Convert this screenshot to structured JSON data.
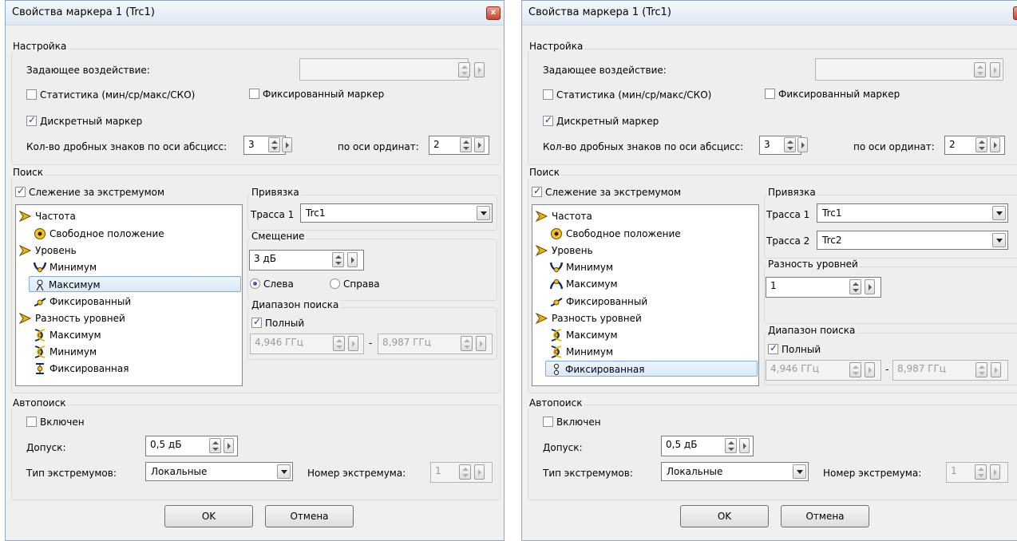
{
  "left": {
    "title": "Свойства маркера 1 (Trc1)",
    "close_label": "x",
    "setup": {
      "title": "Настройка",
      "stimulus_label": "Задающее воздействие:",
      "stimulus_value": "",
      "statistics_label": "Статистика (мин/ср/макс/СКО)",
      "statistics_checked": false,
      "fixed_marker_label": "Фиксированный маркер",
      "fixed_marker_checked": false,
      "discrete_label": "Дискретный маркер",
      "discrete_checked": true,
      "decimals_x_label": "Кол-во дробных знаков по оси абсцисс:",
      "decimals_x_value": "3",
      "decimals_y_label": "по оси ординат:",
      "decimals_y_value": "2"
    },
    "search": {
      "title": "Поиск",
      "tracking_label": "Слежение за экстремумом",
      "tracking_checked": true,
      "tree": [
        {
          "label": "Частота",
          "icon": "frequency-icon"
        },
        {
          "label": "Свободное положение",
          "icon": "free-position-icon"
        },
        {
          "label": "Уровень",
          "icon": "level-icon"
        },
        {
          "label": "Минимум",
          "icon": "minimum-icon"
        },
        {
          "label": "Максимум",
          "icon": "maximum-icon",
          "selected": true
        },
        {
          "label": "Фиксированный",
          "icon": "fixed-icon"
        },
        {
          "label": "Разность уровней",
          "icon": "level-difference-icon"
        },
        {
          "label": "Максимум",
          "icon": "diff-maximum-icon"
        },
        {
          "label": "Минимум",
          "icon": "diff-minimum-icon"
        },
        {
          "label": "Фиксированная",
          "icon": "diff-fixed-icon"
        }
      ],
      "binding": {
        "title": "Привязка",
        "trace1_label": "Трасса 1",
        "trace1_value": "Trc1"
      },
      "offset": {
        "title": "Смещение",
        "value": "3 дБ",
        "left_label": "Слева",
        "right_label": "Справа",
        "selected": "left"
      },
      "range": {
        "title": "Диапазон поиска",
        "full_label": "Полный",
        "full_checked": true,
        "start": "4,946 ГГц",
        "dash": "-",
        "stop": "8,987 ГГц"
      }
    },
    "autosearch": {
      "title": "Автопоиск",
      "enabled_label": "Включен",
      "enabled_checked": false,
      "tolerance_label": "Допуск:",
      "tolerance_value": "0,5 дБ",
      "type_label": "Тип экстремумов:",
      "type_value": "Локальные",
      "number_label": "Номер экстремума:",
      "number_value": "1"
    },
    "ok_label": "OK",
    "cancel_label": "Отмена"
  },
  "right": {
    "title": "Свойства маркера 1 (Trc1)",
    "close_label": "x",
    "setup": {
      "title": "Настройка",
      "stimulus_label": "Задающее воздействие:",
      "stimulus_value": "",
      "statistics_label": "Статистика (мин/ср/макс/СКО)",
      "statistics_checked": false,
      "fixed_marker_label": "Фиксированный маркер",
      "fixed_marker_checked": false,
      "discrete_label": "Дискретный маркер",
      "discrete_checked": true,
      "decimals_x_label": "Кол-во дробных знаков по оси абсцисс:",
      "decimals_x_value": "3",
      "decimals_y_label": "по оси ординат:",
      "decimals_y_value": "2"
    },
    "search": {
      "title": "Поиск",
      "tracking_label": "Слежение за экстремумом",
      "tracking_checked": true,
      "tree": [
        {
          "label": "Частота",
          "icon": "frequency-icon"
        },
        {
          "label": "Свободное положение",
          "icon": "free-position-icon"
        },
        {
          "label": "Уровень",
          "icon": "level-icon"
        },
        {
          "label": "Минимум",
          "icon": "minimum-icon"
        },
        {
          "label": "Максимум",
          "icon": "maximum-icon"
        },
        {
          "label": "Фиксированный",
          "icon": "fixed-icon"
        },
        {
          "label": "Разность уровней",
          "icon": "level-difference-icon"
        },
        {
          "label": "Максимум",
          "icon": "diff-maximum-icon"
        },
        {
          "label": "Минимум",
          "icon": "diff-minimum-icon"
        },
        {
          "label": "Фиксированная",
          "icon": "diff-fixed-icon",
          "selected": true
        }
      ],
      "binding": {
        "title": "Привязка",
        "trace1_label": "Трасса 1",
        "trace1_value": "Trc1",
        "trace2_label": "Трасса 2",
        "trace2_value": "Trc2"
      },
      "diff": {
        "title": "Разность уровней",
        "value": "1"
      },
      "range": {
        "title": "Диапазон поиска",
        "full_label": "Полный",
        "full_checked": true,
        "start": "4,946 ГГц",
        "dash": "-",
        "stop": "8,987 ГГц"
      }
    },
    "autosearch": {
      "title": "Автопоиск",
      "enabled_label": "Включен",
      "enabled_checked": false,
      "tolerance_label": "Допуск:",
      "tolerance_value": "0,5 дБ",
      "type_label": "Тип экстремумов:",
      "type_value": "Локальные",
      "number_label": "Номер экстремума:",
      "number_value": "1"
    },
    "ok_label": "OK",
    "cancel_label": "Отмена"
  }
}
